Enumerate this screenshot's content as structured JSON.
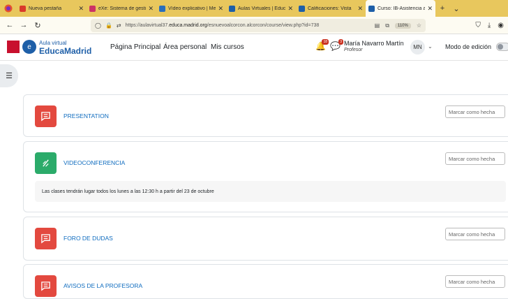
{
  "browser": {
    "tabs": [
      {
        "label": "Nueva pestaña",
        "color": "#d93a2b"
      },
      {
        "label": "eXe: Sistema de gesti",
        "color": "#cc3366"
      },
      {
        "label": "Vídeo explicativo | Me",
        "color": "#2a6ebb"
      },
      {
        "label": "Aulas Virtuales | Educ",
        "color": "#1e5fa8"
      },
      {
        "label": "Calificaciones: Vista",
        "color": "#1e5fa8"
      },
      {
        "label": "Curso: IB-Asistencia a",
        "color": "#1e5fa8"
      }
    ],
    "url_prefix": "https://aulavirtual37.",
    "url_domain": "educa.madrid.org",
    "url_suffix": "/esnuevoalcorcon.alcorcon/course/view.php?id=738",
    "zoom": "110%"
  },
  "header": {
    "logo_top": "Aula virtual",
    "logo_main": "EducaMadrid",
    "nav": [
      "Página Principal",
      "Área personal",
      "Mis cursos"
    ],
    "notif_count": "18",
    "msg_count": "3",
    "user_name": "María Navarro Martín",
    "user_role": "Profesor",
    "initials": "MN",
    "edit_mode_label": "Modo de edición"
  },
  "activities": [
    {
      "title": "PRESENTATION",
      "button": "Marcar como hecha",
      "icon": "forum-icon",
      "color": "#e3493f"
    },
    {
      "title": "VIDEOCONFERENCIA",
      "button": "Marcar como hecha",
      "icon": "video-icon",
      "color": "#2bab6a",
      "note": "Las clases tendrán lugar todos los lunes a las 12:30 h a partir del 23 de octubre"
    },
    {
      "title": "FORO DE DUDAS",
      "button": "Marcar como hecha",
      "icon": "forum-icon",
      "color": "#e3493f"
    },
    {
      "title": "AVISOS DE LA PROFESORA",
      "button": "Marcar como hecha",
      "icon": "forum-icon",
      "color": "#e3493f"
    }
  ]
}
